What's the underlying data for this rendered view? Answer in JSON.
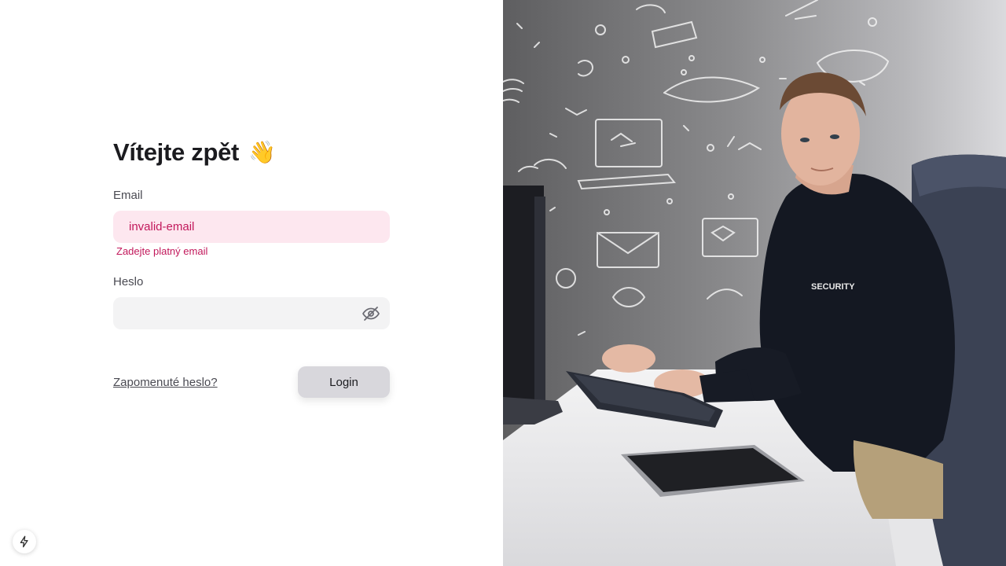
{
  "login": {
    "title": "Vítejte zpět",
    "title_emoji": "👋",
    "email_label": "Email",
    "email_value": "invalid-email",
    "email_error": "Zadejte platný email",
    "password_label": "Heslo",
    "password_value": "",
    "forgot_link": "Zapomenuté heslo?",
    "login_button": "Login"
  },
  "hero_image": {
    "shirt_text": "SECURITY"
  },
  "icons": {
    "password_toggle": "eye-off-icon",
    "bottom_left": "lightning-icon"
  },
  "colors": {
    "error": "#c2185b",
    "error_bg": "#fde7ef",
    "input_bg": "#f3f3f4",
    "button_bg": "#d8d7dc"
  }
}
